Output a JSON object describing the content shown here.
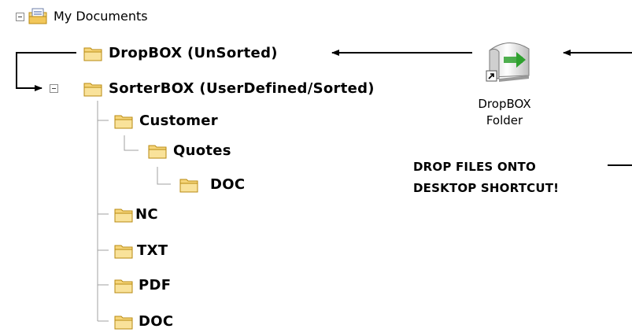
{
  "tree": {
    "root_label": "My Documents",
    "dropbox_label": "DropBOX (UnSorted)",
    "sorterbox_label": "SorterBOX (UserDefined/Sorted)",
    "customer_label": "Customer",
    "quotes_label": "Quotes",
    "quotes_doc_label": "DOC",
    "nc_label": "NC",
    "txt_label": "TXT",
    "pdf_label": "PDF",
    "doc_label": "DOC"
  },
  "shortcut": {
    "icon": "dropbox-shortcut-icon",
    "caption_line1": "DropBOX",
    "caption_line2": "Folder"
  },
  "note": {
    "line1": "DROP FILES ONTO",
    "line2": "DESKTOP SHORTCUT!"
  },
  "icons": {
    "folder": "folder-icon",
    "documents": "my-documents-icon",
    "collapse": "collapse-toggle-icon"
  },
  "colors": {
    "folder_fill": "#f6d57a",
    "folder_outline": "#b88a10",
    "tree_line": "#a0a0a0",
    "arrow": "#000000",
    "shortcut_green": "#2fa12f"
  }
}
